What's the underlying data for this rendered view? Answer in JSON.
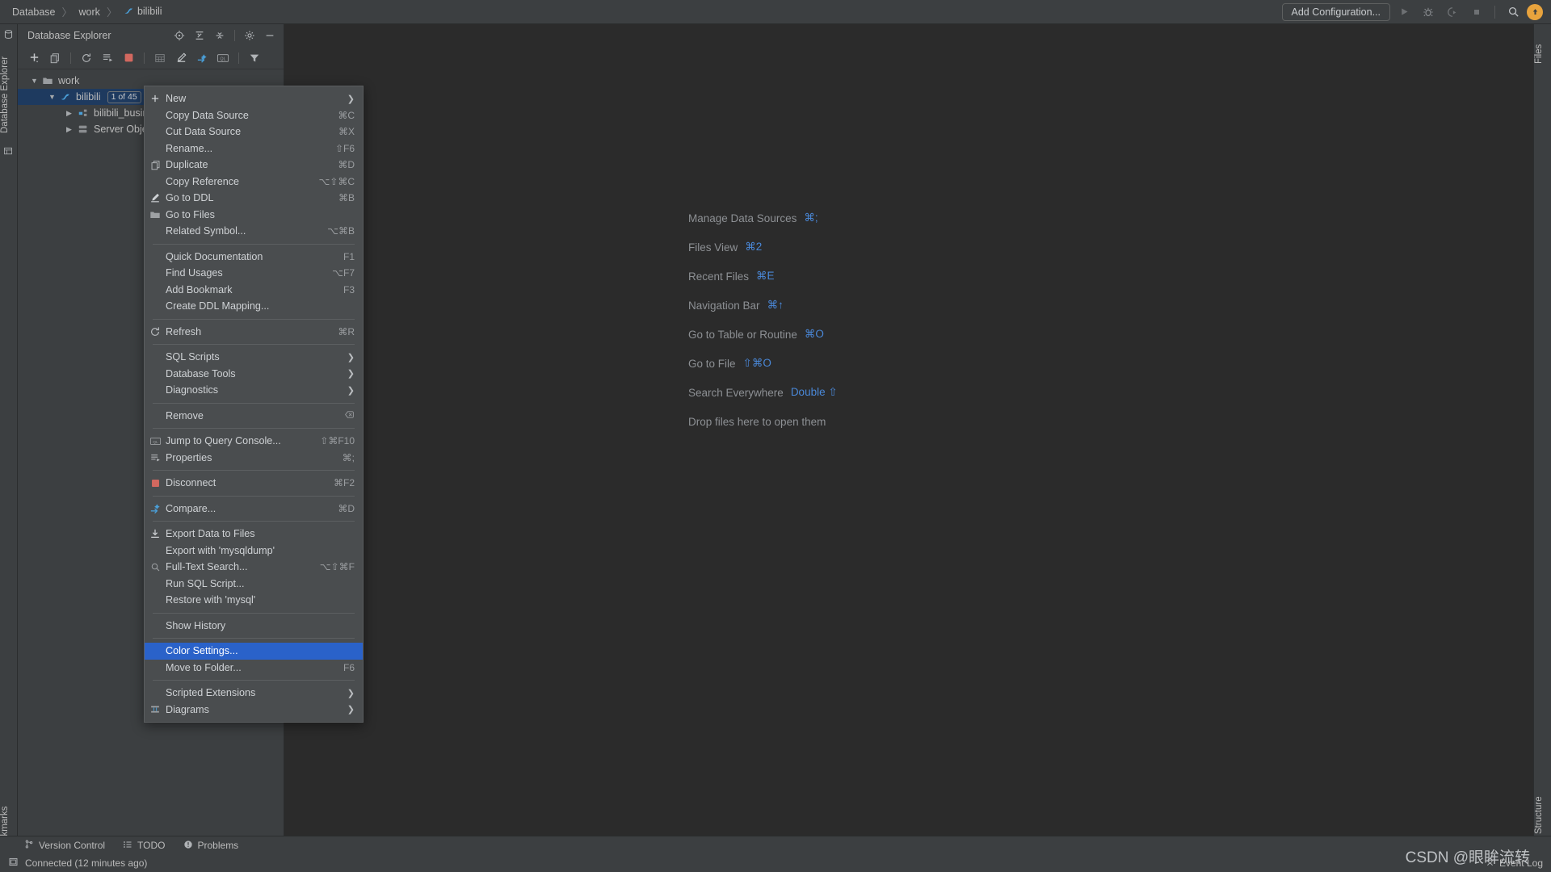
{
  "breadcrumb": {
    "items": [
      {
        "label": "Database",
        "icon": ""
      },
      {
        "label": "work",
        "icon": ""
      },
      {
        "label": "bilibili",
        "icon": "mysql-dolphin-icon"
      }
    ],
    "separator": "〉"
  },
  "toolbar_right": {
    "add_configuration": "Add Configuration...",
    "icons": [
      "run-icon",
      "debug-icon",
      "run-with-coverage-icon",
      "stop-icon",
      "search-icon",
      "update-available-icon"
    ]
  },
  "left_strip": {
    "tabs": [
      "Database Explorer",
      "Bookmarks"
    ]
  },
  "right_strip": {
    "tabs": [
      "Files",
      "Structure"
    ]
  },
  "db_explorer": {
    "title": "Database Explorer",
    "header_icons": [
      "locate-icon",
      "expand-all-icon",
      "collapse-all-icon",
      "settings-gear-icon",
      "hide-icon"
    ],
    "toolbar_icons": [
      "add-icon",
      "copy-icon",
      "refresh-icon",
      "sql-script-icon",
      "stop-red-icon",
      "table-icon",
      "edit-icon",
      "compare-icon",
      "query-console-icon",
      "filter-icon"
    ],
    "tree": [
      {
        "label": "work",
        "level": 1,
        "expanded": true,
        "icon": "folder-icon",
        "selected": false,
        "badge": ""
      },
      {
        "label": "bilibili",
        "level": 2,
        "expanded": true,
        "icon": "mysql-dolphin-icon",
        "selected": true,
        "badge": "1 of 45"
      },
      {
        "label": "bilibili_busin",
        "level": 3,
        "expanded": false,
        "icon": "schema-icon",
        "selected": false,
        "badge": ""
      },
      {
        "label": "Server Objec",
        "level": 3,
        "expanded": false,
        "icon": "server-objects-icon",
        "selected": false,
        "badge": ""
      }
    ]
  },
  "welcome": {
    "rows": [
      {
        "label": "Manage Data Sources",
        "key": "⌘;"
      },
      {
        "label": "Files View",
        "key": "⌘2"
      },
      {
        "label": "Recent Files",
        "key": "⌘E"
      },
      {
        "label": "Navigation Bar",
        "key": "⌘↑"
      },
      {
        "label": "Go to Table or Routine",
        "key": "⌘O"
      },
      {
        "label": "Go to File",
        "key": "⇧⌘O"
      },
      {
        "label": "Search Everywhere",
        "key": "Double ⇧"
      },
      {
        "label": "Drop files here to open them",
        "key": ""
      }
    ]
  },
  "context_menu": {
    "selected_item": "Color Settings...",
    "groups": [
      {
        "items": [
          {
            "label": "New",
            "shortcut": "",
            "icon": "plus-icon",
            "submenu": true
          },
          {
            "label": "Copy Data Source",
            "shortcut": "⌘C",
            "icon": "",
            "submenu": false
          },
          {
            "label": "Cut Data Source",
            "shortcut": "⌘X",
            "icon": "",
            "submenu": false
          },
          {
            "label": "Rename...",
            "shortcut": "⇧F6",
            "icon": "",
            "submenu": false
          },
          {
            "label": "Duplicate",
            "shortcut": "⌘D",
            "icon": "duplicate-icon",
            "submenu": false
          },
          {
            "label": "Copy Reference",
            "shortcut": "⌥⇧⌘C",
            "icon": "",
            "submenu": false
          },
          {
            "label": "Go to DDL",
            "shortcut": "⌘B",
            "icon": "pencil-icon",
            "submenu": false
          },
          {
            "label": "Go to Files",
            "shortcut": "",
            "icon": "folder-icon",
            "submenu": false
          },
          {
            "label": "Related Symbol...",
            "shortcut": "⌥⌘B",
            "icon": "",
            "submenu": false
          }
        ]
      },
      {
        "items": [
          {
            "label": "Quick Documentation",
            "shortcut": "F1",
            "icon": "",
            "submenu": false
          },
          {
            "label": "Find Usages",
            "shortcut": "⌥F7",
            "icon": "",
            "submenu": false
          },
          {
            "label": "Add Bookmark",
            "shortcut": "F3",
            "icon": "",
            "submenu": false
          },
          {
            "label": "Create DDL Mapping...",
            "shortcut": "",
            "icon": "",
            "submenu": false
          }
        ]
      },
      {
        "items": [
          {
            "label": "Refresh",
            "shortcut": "⌘R",
            "icon": "refresh-icon",
            "submenu": false
          }
        ]
      },
      {
        "items": [
          {
            "label": "SQL Scripts",
            "shortcut": "",
            "icon": "",
            "submenu": true
          },
          {
            "label": "Database Tools",
            "shortcut": "",
            "icon": "",
            "submenu": true
          },
          {
            "label": "Diagnostics",
            "shortcut": "",
            "icon": "",
            "submenu": true
          }
        ]
      },
      {
        "items": [
          {
            "label": "Remove",
            "shortcut": "",
            "icon": "",
            "submenu": false,
            "trailing_icon": "delete-icon"
          }
        ]
      },
      {
        "items": [
          {
            "label": "Jump to Query Console...",
            "shortcut": "⇧⌘F10",
            "icon": "query-console-icon",
            "submenu": false
          },
          {
            "label": "Properties",
            "shortcut": "⌘;",
            "icon": "properties-icon",
            "submenu": false
          }
        ]
      },
      {
        "items": [
          {
            "label": "Disconnect",
            "shortcut": "⌘F2",
            "icon": "stop-red-icon",
            "submenu": false
          }
        ]
      },
      {
        "items": [
          {
            "label": "Compare...",
            "shortcut": "⌘D",
            "icon": "compare-icon",
            "submenu": false
          }
        ]
      },
      {
        "items": [
          {
            "label": "Export Data to Files",
            "shortcut": "",
            "icon": "download-icon",
            "submenu": false
          },
          {
            "label": "Export with 'mysqldump'",
            "shortcut": "",
            "icon": "",
            "submenu": false
          },
          {
            "label": "Full-Text Search...",
            "shortcut": "⌥⇧⌘F",
            "icon": "search-icon",
            "submenu": false
          },
          {
            "label": "Run SQL Script...",
            "shortcut": "",
            "icon": "",
            "submenu": false
          },
          {
            "label": "Restore with 'mysql'",
            "shortcut": "",
            "icon": "",
            "submenu": false
          }
        ]
      },
      {
        "items": [
          {
            "label": "Show History",
            "shortcut": "",
            "icon": "",
            "submenu": false
          }
        ]
      },
      {
        "items": [
          {
            "label": "Color Settings...",
            "shortcut": "",
            "icon": "",
            "submenu": false,
            "selected": true
          },
          {
            "label": "Move to Folder...",
            "shortcut": "F6",
            "icon": "",
            "submenu": false
          }
        ]
      },
      {
        "items": [
          {
            "label": "Scripted Extensions",
            "shortcut": "",
            "icon": "",
            "submenu": true
          },
          {
            "label": "Diagrams",
            "shortcut": "",
            "icon": "diagram-icon",
            "submenu": true
          }
        ]
      }
    ]
  },
  "tool_window_bar": {
    "items": [
      {
        "label": "Version Control",
        "icon": "branch-icon"
      },
      {
        "label": "TODO",
        "icon": "todo-list-icon"
      },
      {
        "label": "Problems",
        "icon": "problems-icon"
      }
    ]
  },
  "status_bar": {
    "left_icon": "db-connection-icon",
    "message": "Connected (12 minutes ago)",
    "event_log": "Event Log",
    "event_log_icon": "event-log-icon"
  },
  "watermark": "CSDN @眼眸流转",
  "colors": {
    "accent_blue": "#4a88d8",
    "selection_blue": "#2a62c9",
    "tree_selection": "#1e3a5f",
    "menu_bg": "#4a4d4f",
    "panel_bg": "#3c3f41",
    "editor_bg": "#2b2b2b",
    "red_stop": "#d2685f",
    "avatar_orange": "#e8a33d"
  }
}
